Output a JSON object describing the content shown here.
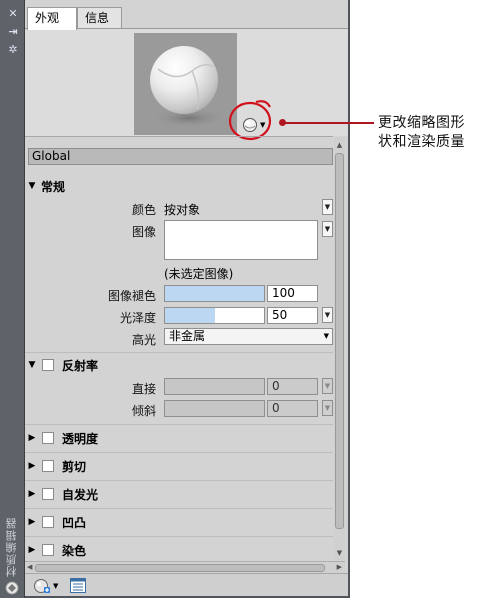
{
  "sidebar": {
    "vertical_title": "材质编辑器"
  },
  "tabs": [
    {
      "label": "外观",
      "active": true
    },
    {
      "label": "信息",
      "active": false
    }
  ],
  "global_label": "Global",
  "sections": {
    "general": {
      "label": "常规",
      "color_label": "颜色",
      "color_value": "按对象",
      "image_label": "图像",
      "image_status": "(未选定图像)",
      "fade_label": "图像褪色",
      "fade_value": "100",
      "fade_level_percent": 100,
      "gloss_label": "光泽度",
      "gloss_value": "50",
      "gloss_level_percent": 50,
      "highlight_label": "高光",
      "highlight_value": "非金属"
    },
    "reflectivity": {
      "label": "反射率",
      "direct_label": "直接",
      "direct_value": "0",
      "oblique_label": "倾斜",
      "oblique_value": "0"
    },
    "collapsed": [
      {
        "label": "透明度"
      },
      {
        "label": "剪切"
      },
      {
        "label": "自发光"
      },
      {
        "label": "凹凸"
      },
      {
        "label": "染色"
      }
    ]
  },
  "annotation": {
    "text": "更改缩略图形状和渲染质量",
    "color": "#b01522"
  },
  "colors": {
    "slider_fill": "#bcd7f1",
    "panel_bg": "#d3d3d3",
    "sidebar_bg": "#5d6368"
  }
}
